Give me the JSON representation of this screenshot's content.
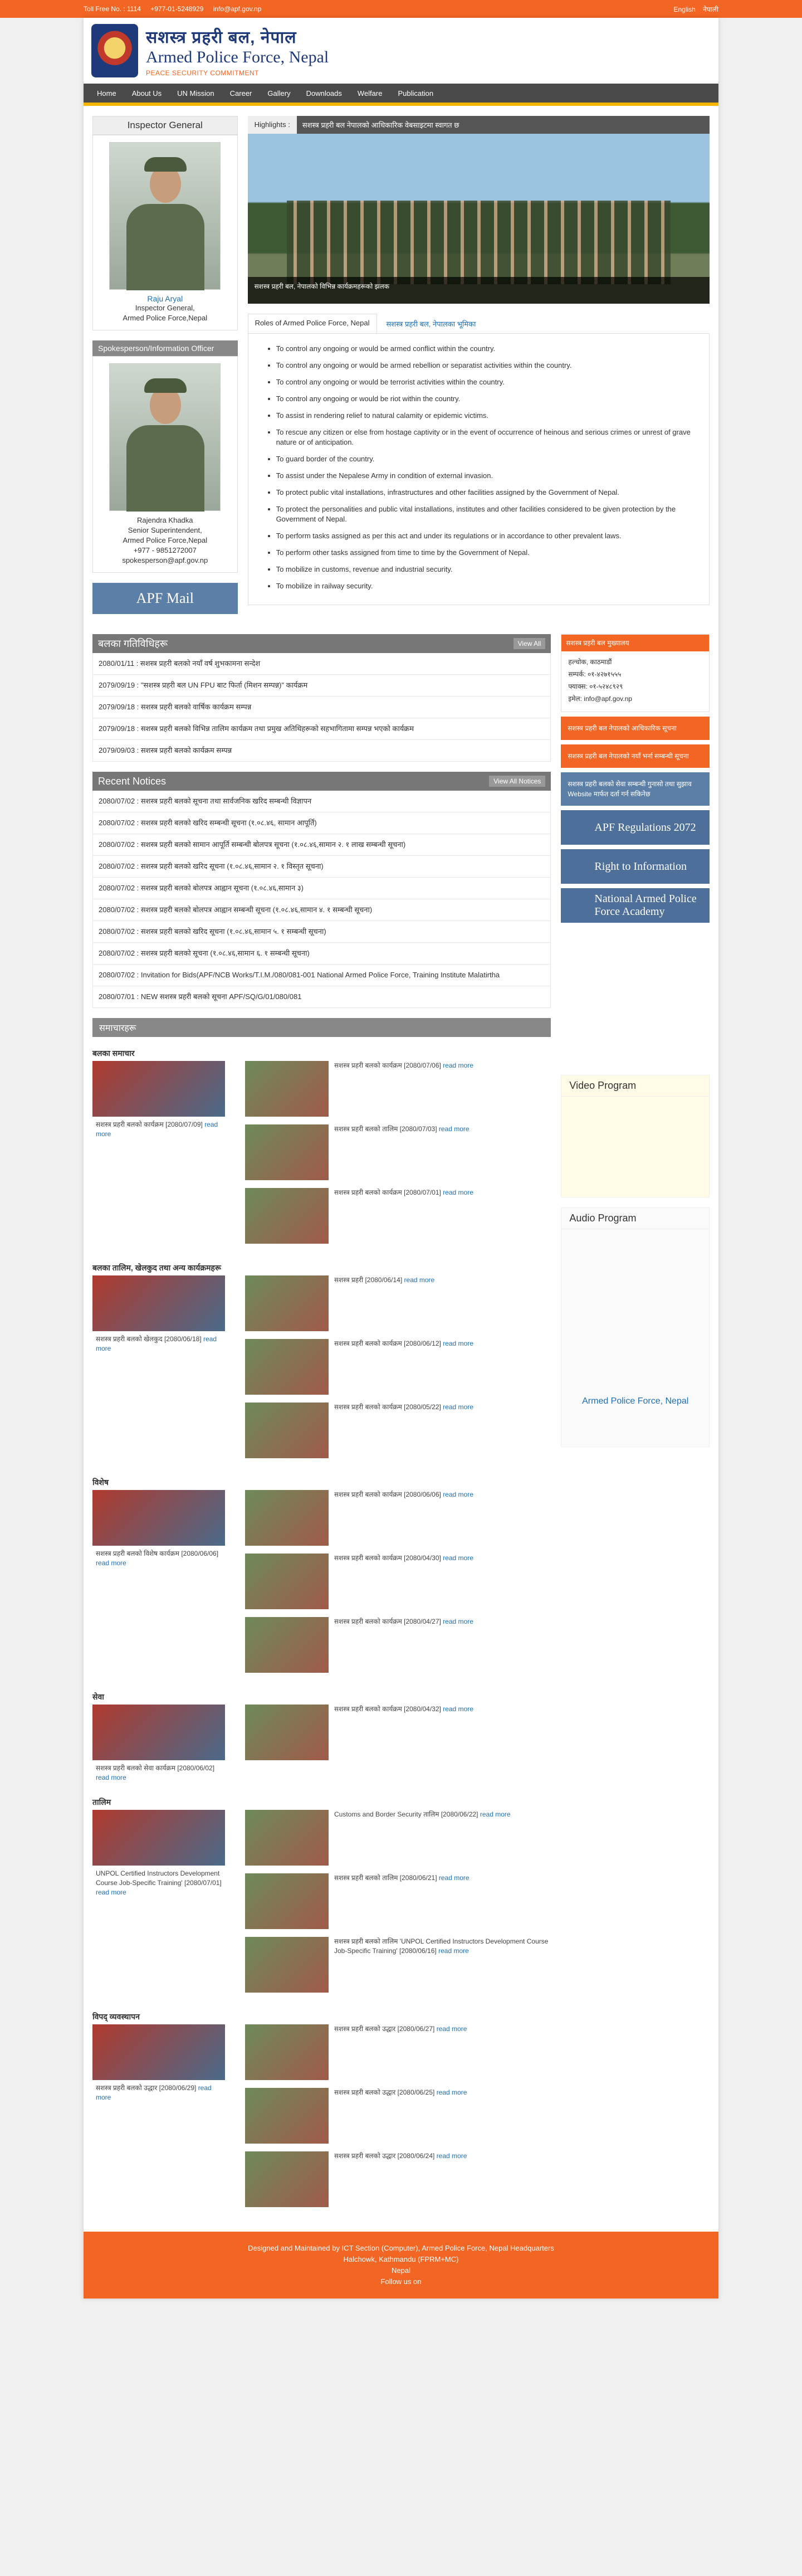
{
  "topbar": {
    "toll": "Toll Free No. : 1114",
    "phone": "+977-01-5248929",
    "email": "info@apf.gov.np",
    "lang_en": "English",
    "lang_np": "नेपाली"
  },
  "header": {
    "title_np": "सशस्त्र प्रहरी बल, नेपाल",
    "title_en": "Armed Police Force, Nepal",
    "motto": "PEACE SECURITY COMMITMENT"
  },
  "nav": [
    "Home",
    "About Us",
    "UN Mission",
    "Career",
    "Gallery",
    "Downloads",
    "Welfare",
    "Publication"
  ],
  "ig": {
    "heading": "Inspector General",
    "name": "Raju Aryal",
    "title1": "Inspector General,",
    "title2": "Armed Police Force,Nepal"
  },
  "spokes": {
    "heading": "Spokesperson/Information Officer",
    "name": "Rajendra Khadka",
    "title1": "Senior Superintendent,",
    "title2": "Armed Police Force,Nepal",
    "phone": "+977 - 9851272007",
    "email": "spokesperson@apf.gov.np"
  },
  "apf_mail": "APF Mail",
  "highlights": {
    "label": "Highlights :",
    "ticker": "सशस्त्र प्रहरी बल नेपालको आधिकारिक वेबसाइटमा स्वागत छ"
  },
  "slider_caption": "सशस्त्र प्रहरी बल, नेपालको विभिन्न कार्यक्रमहरूको झलक",
  "roles": {
    "tab1": "Roles of Armed Police Force, Nepal",
    "tab2": "सशस्त्र प्रहरी बल, नेपालका भूमिका",
    "items": [
      "To control any ongoing or would be armed conflict within the country.",
      "To control any ongoing or would be armed rebellion or separatist activities within the country.",
      "To control any ongoing or would be terrorist activities within the country.",
      "To control any ongoing or would be riot within the country.",
      "To assist in rendering relief to natural calamity or epidemic victims.",
      "To rescue any citizen or else from hostage captivity or in the event of occurrence of heinous and serious crimes or unrest of grave nature or of anticipation.",
      "To guard border of the country.",
      "To assist under the Nepalese Army in condition of external invasion.",
      "To protect public vital installations, infrastructures and other facilities assigned by the Government of Nepal.",
      "To protect the personalities and public vital installations, institutes and other facilities considered to be given protection by the Government of Nepal.",
      "To perform tasks assigned as per this act and under its regulations or in accordance to other prevalent laws.",
      "To perform other tasks assigned from time to time by the Government of Nepal.",
      "To mobilize in customs, revenue and industrial security.",
      "To mobilize in railway security."
    ]
  },
  "activities": {
    "title": "बलका गतिविधिहरू",
    "view_all": "View All",
    "items": [
      "2080/01/11 : सशस्त्र प्रहरी बलको नयाँ वर्ष शुभकामना सन्देश",
      "2079/09/19 : \"सशस्त्र प्रहरी बल UN FPU बाट फिर्ता (मिशन सम्पन्न)\" कार्यक्रम",
      "2079/09/18 : सशस्त्र प्रहरी बलको वार्षिक कार्यक्रम सम्पन्न",
      "2079/09/18 : सशस्त्र प्रहरी बलको विभिन्न तालिम कार्यक्रम तथा प्रमुख अतिथिहरूको सहभागितामा सम्पन्न भएको कार्यक्रम",
      "2079/09/03 : सशस्त्र प्रहरी बलको कार्यक्रम सम्पन्न"
    ]
  },
  "notices": {
    "title": "Recent Notices",
    "view_all": "View All Notices",
    "items": [
      "2080/07/02 : सशस्त्र प्रहरी बलको सूचना तथा सार्वजनिक खरिद सम्बन्धी विज्ञापन",
      "2080/07/02 : सशस्त्र प्रहरी बलको खरिद सम्बन्धी सूचना (१.०८.४६, सामान आपूर्ति)",
      "2080/07/02 : सशस्त्र प्रहरी बलको सामान आपूर्ति सम्बन्धी बोलपत्र सूचना (१.०८.४६,सामान २. १ लाख सम्बन्धी सूचना)",
      "2080/07/02 : सशस्त्र प्रहरी बलको खरिद सूचना (१.०८.४६,सामान २. १ विस्तृत सूचना)",
      "2080/07/02 : सशस्त्र प्रहरी बलको बोलपत्र आह्वान सूचना (१.०८.४६,सामान ३)",
      "2080/07/02 : सशस्त्र प्रहरी बलको बोलपत्र आह्वान सम्बन्धी सूचना (१.०८.४६,सामान ४. १ सम्बन्धी सूचना)",
      "2080/07/02 : सशस्त्र प्रहरी बलको खरिद सूचना (१.०८.४६,सामान ५. १ सम्बन्धी सूचना)",
      "2080/07/02 : सशस्त्र प्रहरी बलको सूचना (१.०८.४६,सामान ६. १ सम्बन्धी सूचना)",
      "2080/07/02 : Invitation for Bids(APF/NCB Works/T.I.M./080/081-001 National Armed Police Force, Training Institute Malatirtha",
      "2080/07/01 : NEW सशस्त्र प्रहरी बलको सूचना APF/SQ/G/01/080/081"
    ]
  },
  "sidebar": {
    "info_title": "सशस्त्र प्रहरी बल मुख्यालय",
    "info_lines": [
      "हल्चोक, काठमाडौं",
      "सम्पर्क: ०१-४२७१५५५",
      "फ्याक्स: ०१-५२४८९२९",
      "इमेल: info@apf.gov.np"
    ],
    "orange1": "सशस्त्र प्रहरी बल नेपालको आधिकारिक सूचना",
    "orange2": "सशस्त्र प्रहरी बल नेपालको नयाँ भर्ना सम्बन्धी सूचना",
    "blue1": "सशस्त्र प्रहरी बलको सेवा सम्बन्धी गुनासो तथा सुझाव Website मार्फत दर्ता गर्न सकिनेछ",
    "banner1": "APF Regulations 2072",
    "banner2": "Right to Information",
    "banner3": "National Armed Police Force Academy",
    "video": "Video Program",
    "audio": "Audio Program",
    "fb": "Armed Police Force, Nepal"
  },
  "gallery": {
    "title": "समाचारहरू",
    "cats": [
      {
        "title": "बलका समाचार",
        "feat": "सशस्त्र प्रहरी बलको कार्यक्रम [2080/07/09]",
        "list": [
          "सशस्त्र प्रहरी बलको कार्यक्रम [2080/07/06]",
          "सशस्त्र प्रहरी बलको तालिम [2080/07/03]",
          "सशस्त्र प्रहरी बलको कार्यक्रम [2080/07/01]"
        ]
      },
      {
        "title": "बलका तालिम, खेलकुद तथा अन्य कार्यक्रमहरू",
        "feat": "सशस्त्र प्रहरी बलको खेलकुद [2080/06/18]",
        "list": [
          "सशस्त्र प्रहरी [2080/06/14]",
          "सशस्त्र प्रहरी बलको कार्यक्रम [2080/06/12]",
          "सशस्त्र प्रहरी बलको कार्यक्रम [2080/05/22]"
        ]
      },
      {
        "title": "विशेष",
        "feat": "सशस्त्र प्रहरी बलको विशेष कार्यक्रम [2080/06/06]",
        "list": [
          "सशस्त्र प्रहरी बलको कार्यक्रम [2080/06/06]",
          "सशस्त्र प्रहरी बलको कार्यक्रम [2080/04/30]",
          "सशस्त्र प्रहरी बलको कार्यक्रम [2080/04/27]"
        ]
      },
      {
        "title": "सेवा",
        "feat": "सशस्त्र प्रहरी बलको सेवा कार्यक्रम [2080/06/02]",
        "list": [
          "सशस्त्र प्रहरी बलको कार्यक्रम [2080/04/32]"
        ]
      },
      {
        "title": "तालिम",
        "feat": "UNPOL Certified Instructors Development Course Job-Specific Training' [2080/07/01]",
        "list": [
          "Customs and Border Security तालिम [2080/06/22]",
          "सशस्त्र प्रहरी बलको तालिम [2080/06/21]",
          "सशस्त्र प्रहरी बलको तालिम 'UNPOL Certified Instructors Development Course Job-Specific Training' [2080/06/16]"
        ]
      },
      {
        "title": "विपद् व्यवस्थापन",
        "feat": "सशस्त्र प्रहरी बलको उद्धार [2080/06/29]",
        "list": [
          "सशस्त्र प्रहरी बलको उद्धार [2080/06/27]",
          "सशस्त्र प्रहरी बलको उद्धार [2080/06/25]",
          "सशस्त्र प्रहरी बलको उद्धार [2080/06/24]"
        ]
      }
    ],
    "read_more": "read more"
  },
  "footer": {
    "line1": "Designed and Maintained by ICT Section (Computer), Armed Police Force, Nepal Headquarters",
    "line2": "Halchowk, Kathmandu (FPRM+MC)",
    "line3": "Nepal",
    "line4": "Follow us on"
  }
}
